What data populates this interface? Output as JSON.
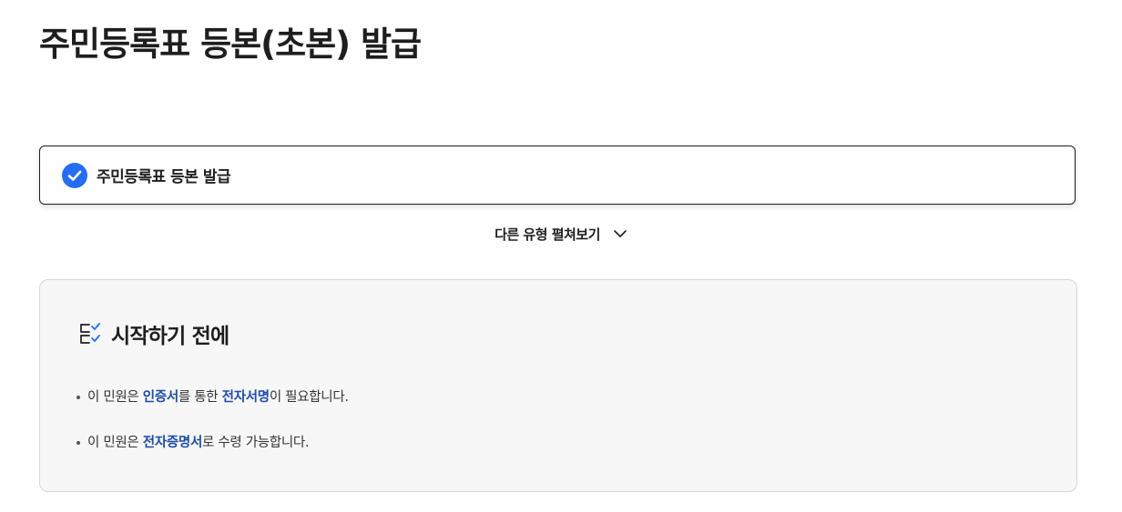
{
  "page": {
    "title": "주민등록표 등본(초본) 발급"
  },
  "selected_type": {
    "label": "주민등록표 등본 발급",
    "icon": "check-circle-icon",
    "check_color": "#256ef4"
  },
  "expand_toggle": {
    "label": "다른 유형 펼쳐보기",
    "icon": "chevron-down-icon"
  },
  "info_box": {
    "icon": "checklist-icon",
    "title": "시작하기 전에",
    "notices": [
      {
        "prefix": "이 민원은 ",
        "highlight1": "인증서",
        "middle": "를 통한 ",
        "highlight2": "전자서명",
        "suffix": "이 필요합니다."
      },
      {
        "prefix": "이 민원은 ",
        "highlight1": "전자증명서",
        "suffix": "로 수령 가능합니다."
      }
    ],
    "highlight_color": "#1c4ba8"
  }
}
